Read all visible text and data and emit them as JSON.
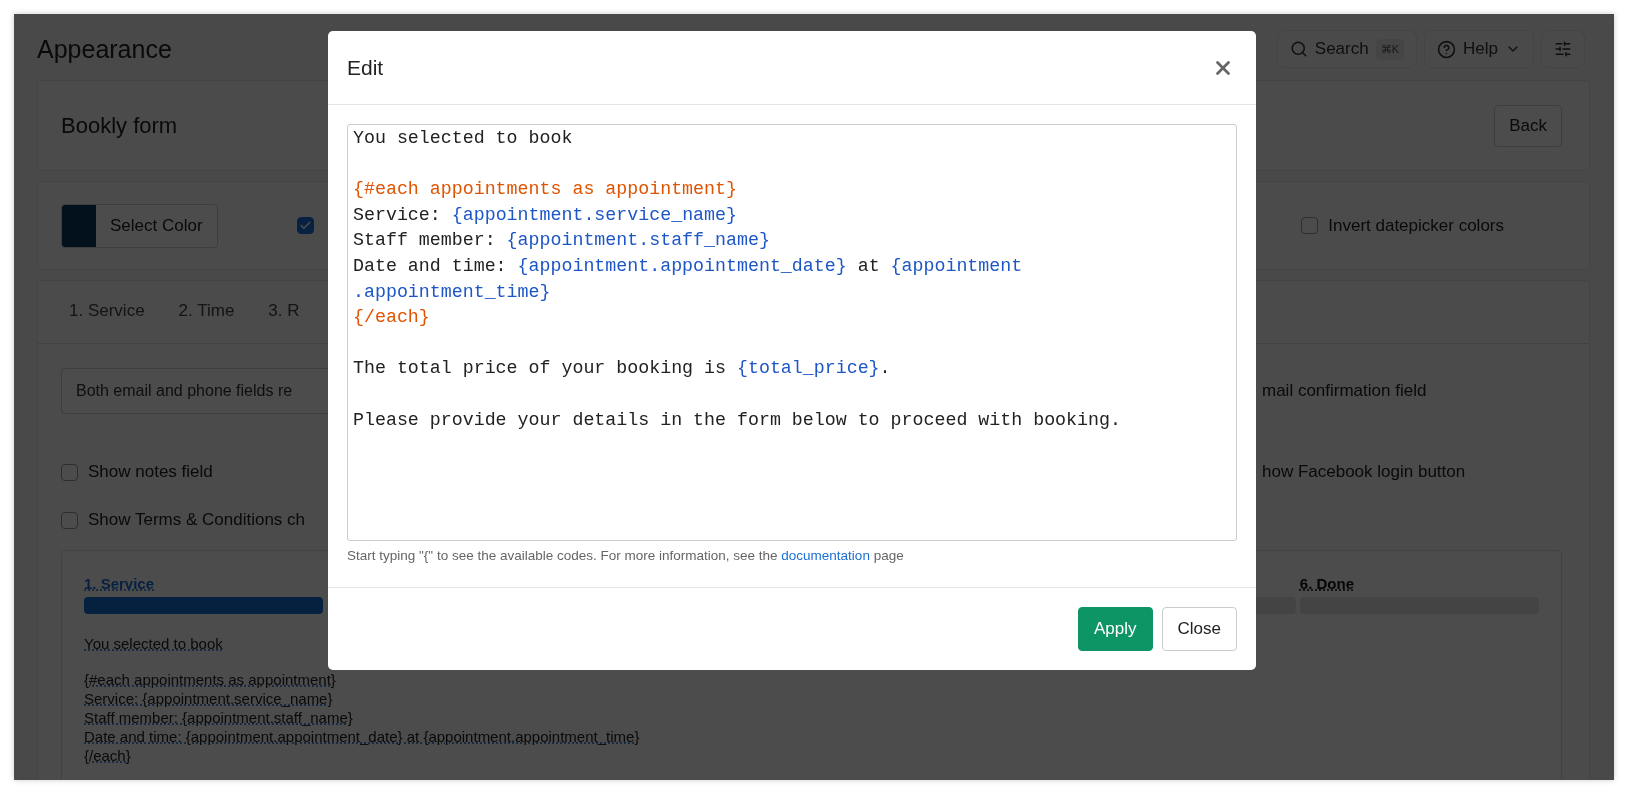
{
  "page": {
    "title": "Appearance",
    "search": {
      "label": "Search",
      "shortcut": "⌘K"
    },
    "help": {
      "label": "Help"
    }
  },
  "form_header": {
    "title": "Bookly form",
    "back_button": "Back"
  },
  "color_bar": {
    "select_color": "Select Color",
    "first_option": {
      "checked": true
    },
    "invert_option": {
      "label": "Invert datepicker colors",
      "checked": false
    }
  },
  "step_tabs": [
    {
      "label": "1. Service",
      "selected": false
    },
    {
      "label": "2. Time",
      "selected": false
    },
    {
      "label": "3. R",
      "selected": false
    }
  ],
  "details": {
    "required_select": {
      "value": "Both email and phone fields re"
    },
    "email_confirmation": {
      "label": "mail confirmation field"
    },
    "options": [
      {
        "label": "Show notes field",
        "checked": false
      },
      {
        "label": "Show Terms & Conditions ch",
        "checked": false
      }
    ],
    "facebook_option": {
      "label": "how Facebook login button"
    }
  },
  "preview": {
    "steps": [
      {
        "label": "1. Service",
        "active": true
      },
      {
        "active": false
      },
      {
        "label": "6. Done",
        "active": false
      }
    ],
    "lines": [
      {
        "kind": "text",
        "text": "You selected to book"
      },
      {
        "kind": "blank"
      },
      {
        "kind": "text",
        "text": "{#each appointments as appointment}"
      },
      {
        "kind": "text",
        "text": "Service: {appointment.service_name}"
      },
      {
        "kind": "text",
        "text": "Staff member: {appointment.staff_name}"
      },
      {
        "kind": "text",
        "text": "Date and time: {appointment.appointment_date} at {appointment.appointment_time}"
      },
      {
        "kind": "text",
        "text": "{/each}"
      }
    ]
  },
  "modal": {
    "title": "Edit",
    "lines": [
      {
        "kind": "text",
        "segments": [
          {
            "kind": "plain",
            "text": "You selected to book"
          }
        ]
      },
      {
        "kind": "blank"
      },
      {
        "kind": "text",
        "segments": [
          {
            "kind": "block",
            "text": "{#each appointments as appointment}"
          }
        ]
      },
      {
        "kind": "text",
        "segments": [
          {
            "kind": "plain",
            "text": "Service: "
          },
          {
            "kind": "code",
            "text": "{appointment.service_name}"
          }
        ]
      },
      {
        "kind": "text",
        "segments": [
          {
            "kind": "plain",
            "text": "Staff member: "
          },
          {
            "kind": "code",
            "text": "{appointment.staff_name}"
          }
        ]
      },
      {
        "kind": "text",
        "segments": [
          {
            "kind": "plain",
            "text": "Date and time: "
          },
          {
            "kind": "code",
            "text": "{appointment.appointment_date}"
          },
          {
            "kind": "plain",
            "text": " at "
          },
          {
            "kind": "code",
            "text": "{appointment"
          }
        ]
      },
      {
        "kind": "text",
        "segments": [
          {
            "kind": "code",
            "text": ".appointment_time}"
          }
        ]
      },
      {
        "kind": "text",
        "segments": [
          {
            "kind": "block",
            "text": "{/each}"
          }
        ]
      },
      {
        "kind": "blank"
      },
      {
        "kind": "text",
        "segments": [
          {
            "kind": "plain",
            "text": "The total price of your booking is "
          },
          {
            "kind": "code",
            "text": "{total_price}"
          },
          {
            "kind": "plain",
            "text": "."
          }
        ]
      },
      {
        "kind": "blank"
      },
      {
        "kind": "text",
        "segments": [
          {
            "kind": "plain",
            "text": "Please provide your details in the form below to proceed with booking."
          }
        ]
      }
    ],
    "hint": {
      "before": "Start typing \"{\" to see the available codes. For more information, see the ",
      "link": "documentation",
      "after": " page"
    },
    "buttons": [
      {
        "label": "Apply",
        "kind": "primary"
      },
      {
        "label": "Close",
        "kind": "secondary"
      }
    ]
  }
}
